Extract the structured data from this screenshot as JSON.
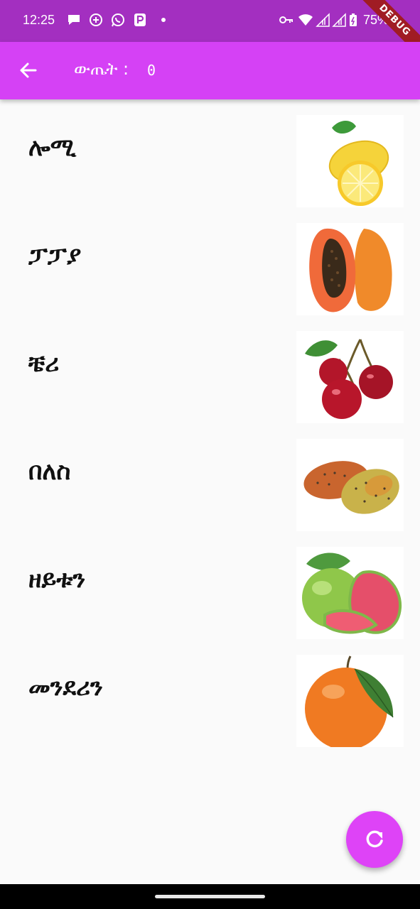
{
  "status_bar": {
    "time": "12:25",
    "battery": "75%",
    "icons": [
      "chat-bubble-icon",
      "add-circle-icon",
      "whatsapp-icon",
      "p-app-icon",
      "dot-icon",
      "key-icon",
      "wifi-icon",
      "signal-icon",
      "signal-icon",
      "battery-icon"
    ]
  },
  "debug_banner": "DEBUG",
  "app_bar": {
    "title": "ውጤት :",
    "score": "0",
    "back_icon": "arrow-back-icon"
  },
  "fruits": [
    {
      "label": "ሎሚ",
      "image": "lemon"
    },
    {
      "label": "ፓፓያ",
      "image": "papaya"
    },
    {
      "label": "ቼሪ",
      "image": "cherry"
    },
    {
      "label": "በለስ",
      "image": "prickly-pear"
    },
    {
      "label": "ዘይቱን",
      "image": "guava"
    },
    {
      "label": "መንደሪን",
      "image": "orange"
    }
  ],
  "fab": {
    "icon": "refresh-icon"
  },
  "colors": {
    "status_bar": "#a32fc0",
    "app_bar": "#d541f5",
    "fab": "#de43f7",
    "background": "#fafafa"
  }
}
